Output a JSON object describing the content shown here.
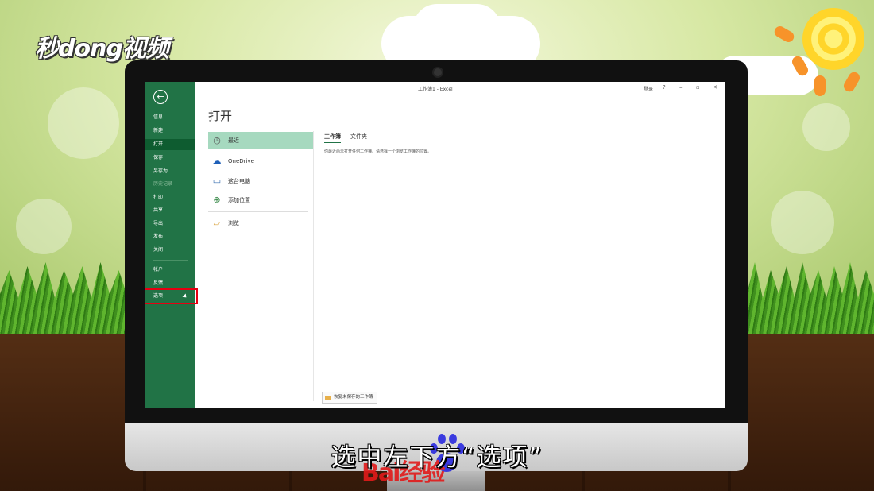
{
  "logo_text": "秒dong视频",
  "window": {
    "title": "工作簿1 - Excel",
    "login": "登录",
    "help": "?",
    "minimize": "–",
    "restore": "▫",
    "close": "✕"
  },
  "sidebar": {
    "back_icon": "←",
    "items": [
      {
        "label": "信息"
      },
      {
        "label": "新建"
      },
      {
        "label": "打开"
      },
      {
        "label": "保存"
      },
      {
        "label": "另存为"
      },
      {
        "label": "历史记录"
      },
      {
        "label": "打印"
      },
      {
        "label": "共享"
      },
      {
        "label": "导出"
      },
      {
        "label": "发布"
      },
      {
        "label": "关闭"
      }
    ],
    "bottom_items": [
      {
        "label": "帐户"
      },
      {
        "label": "反馈"
      },
      {
        "label": "选项"
      }
    ]
  },
  "main": {
    "heading": "打开",
    "locations": [
      {
        "label": "最近",
        "icon": "clock-icon",
        "glyph": "◷"
      },
      {
        "label": "OneDrive",
        "icon": "cloud-icon",
        "glyph": "☁"
      },
      {
        "label": "这台电脑",
        "icon": "computer-icon",
        "glyph": "▭"
      },
      {
        "label": "添加位置",
        "icon": "add-location-icon",
        "glyph": "⊕"
      },
      {
        "label": "浏览",
        "icon": "folder-icon",
        "glyph": "▱"
      }
    ],
    "tabs": [
      {
        "label": "工作簿"
      },
      {
        "label": "文件夹"
      }
    ],
    "info_text": "你最近尚未打开任何工作簿。请选择一个浏览工作簿的位置。",
    "recover_button": "恢复未保存的工作簿"
  },
  "subtitle": "选中左下方“选项”",
  "watermark_text": "Bai经验",
  "colors": {
    "excel_green": "#217346",
    "selected_location": "#a6d9bf",
    "highlight_box": "#e60012"
  }
}
